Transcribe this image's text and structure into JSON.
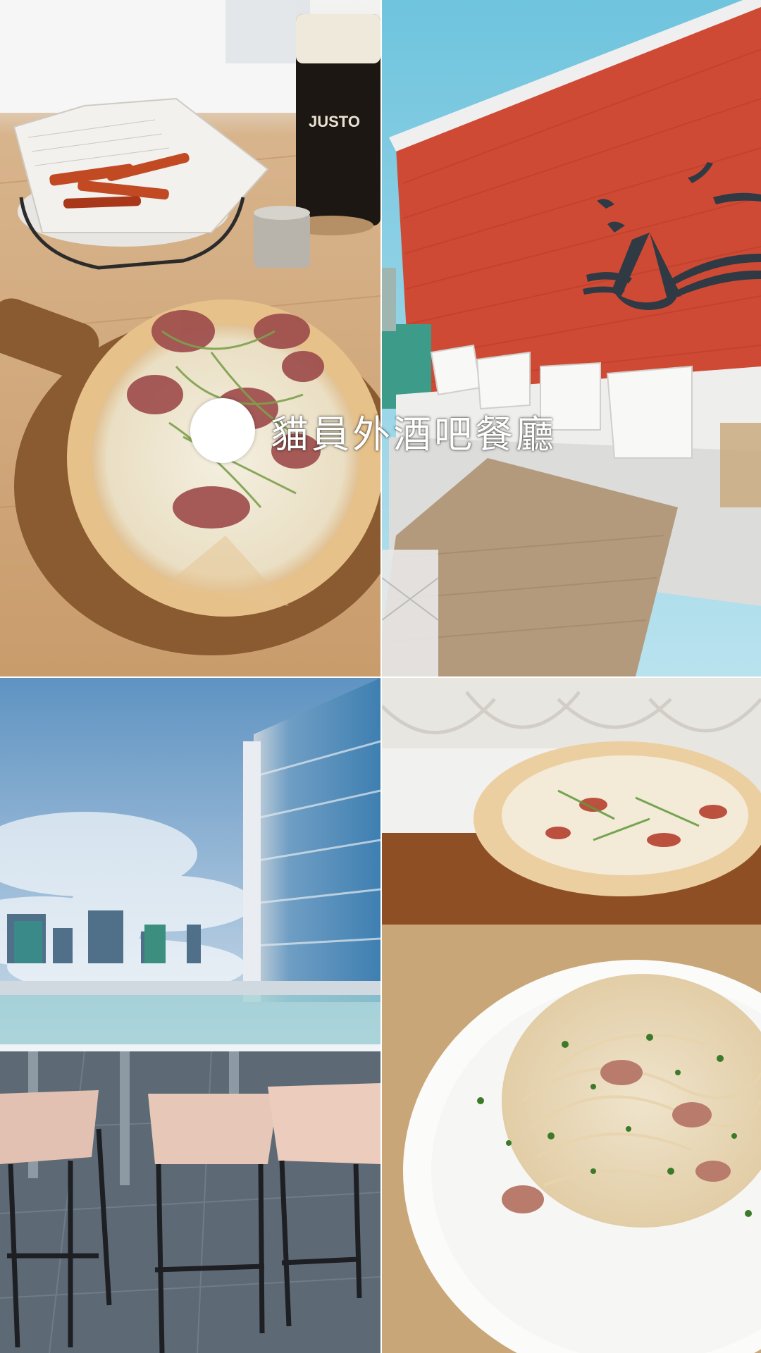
{
  "caption": {
    "title": "貓員外酒吧餐廳"
  },
  "photos": [
    {
      "position": "top-left",
      "subject": "pizza-fries-beer",
      "label_text": "JUSTO"
    },
    {
      "position": "top-right",
      "subject": "red-wall-cat-logo-lounge"
    },
    {
      "position": "bottom-left",
      "subject": "city-skyline-bar-stools"
    },
    {
      "position": "bottom-right",
      "subject": "carbonara-pasta-and-pizza"
    }
  ]
}
